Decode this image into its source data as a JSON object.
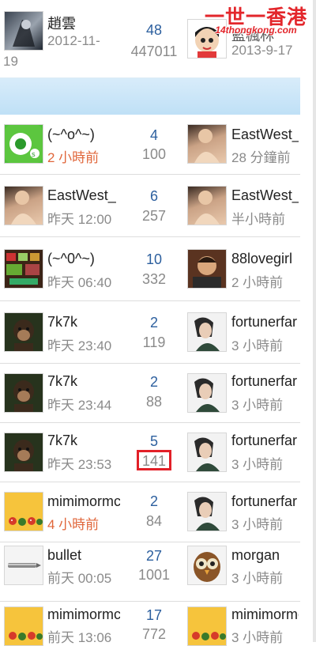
{
  "watermark": {
    "title": "一世一香港",
    "subtitle": "14thongkong.com"
  },
  "header_row": {
    "left_name": "趙雲",
    "left_time_line1": "2012-11-",
    "left_time_line2": "19",
    "num1": "48",
    "num2": "447011",
    "right_name": "藍楓林",
    "right_time": "2013-9-17"
  },
  "rows": [
    {
      "left_name": "(~^o^~)",
      "left_time": "2 小時前",
      "num1": "4",
      "num2": "100",
      "right_name": "EastWest_",
      "right_time": "28 分鐘前"
    },
    {
      "left_name": "EastWest_",
      "left_time": "昨天 12:00",
      "num1": "6",
      "num2": "257",
      "right_name": "EastWest_",
      "right_time": "半小時前"
    },
    {
      "left_name": "(~^0^~)",
      "left_time": "昨天 06:40",
      "num1": "10",
      "num2": "332",
      "right_name": "88lovegirl",
      "right_time": "2 小時前"
    },
    {
      "left_name": "7k7k",
      "left_time": "昨天 23:40",
      "num1": "2",
      "num2": "119",
      "right_name": "fortunerfar",
      "right_time": "3 小時前"
    },
    {
      "left_name": "7k7k",
      "left_time": "昨天 23:44",
      "num1": "2",
      "num2": "88",
      "right_name": "fortunerfar",
      "right_time": "3 小時前"
    },
    {
      "left_name": "7k7k",
      "left_time": "昨天 23:53",
      "num1": "5",
      "num2": "141",
      "right_name": "fortunerfar",
      "right_time": "3 小時前"
    },
    {
      "left_name": "mimimormc",
      "left_time": "4 小時前",
      "num1": "2",
      "num2": "84",
      "right_name": "fortunerfar",
      "right_time": "3 小時前"
    },
    {
      "left_name": "bullet",
      "left_time": "前天 00:05",
      "num1": "27",
      "num2": "1001",
      "right_name": "morgan",
      "right_time": "3 小時前"
    },
    {
      "left_name": "mimimormc",
      "left_time": "前天 13:06",
      "num1": "17",
      "num2": "772",
      "right_name": "mimimormc",
      "right_time": "3 小時前"
    }
  ]
}
